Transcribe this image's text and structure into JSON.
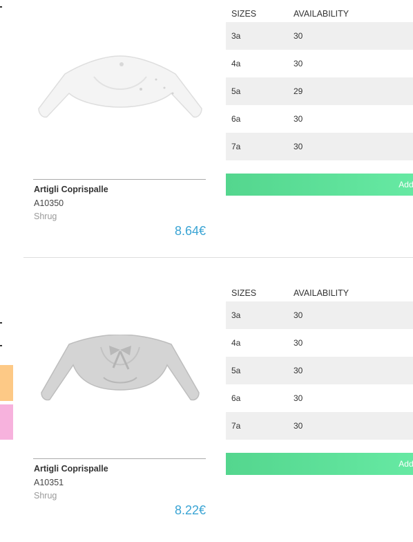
{
  "sidebar": {
    "swatches": [
      {
        "color": "#fdc986",
        "name": "orange"
      },
      {
        "color": "#f7b2dd",
        "name": "pink"
      }
    ]
  },
  "table_headers": {
    "size": "SIZES",
    "availability": "AVAILABILITY"
  },
  "add_button_label": "Add to",
  "products": [
    {
      "name": "Artigli Coprispalle",
      "code": "A10350",
      "category": "Shrug",
      "price": "8.64€",
      "image": "white-bolero-shrug",
      "sizes": [
        {
          "size": "3a",
          "availability": "30"
        },
        {
          "size": "4a",
          "availability": "30"
        },
        {
          "size": "5a",
          "availability": "29"
        },
        {
          "size": "6a",
          "availability": "30"
        },
        {
          "size": "7a",
          "availability": "30"
        }
      ]
    },
    {
      "name": "Artigli Coprispalle",
      "code": "A10351",
      "category": "Shrug",
      "price": "8.22€",
      "image": "grey-bolero-shrug-with-bow",
      "sizes": [
        {
          "size": "3a",
          "availability": "30"
        },
        {
          "size": "4a",
          "availability": "30"
        },
        {
          "size": "5a",
          "availability": "30"
        },
        {
          "size": "6a",
          "availability": "30"
        },
        {
          "size": "7a",
          "availability": "30"
        }
      ]
    }
  ]
}
